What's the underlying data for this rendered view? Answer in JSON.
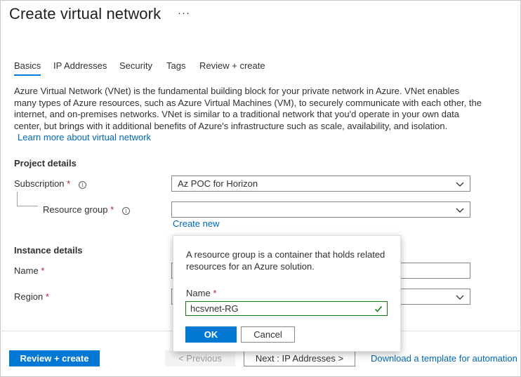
{
  "header": {
    "title": "Create virtual network",
    "more": "···"
  },
  "tabs": [
    {
      "label": "Basics"
    },
    {
      "label": "IP Addresses"
    },
    {
      "label": "Security"
    },
    {
      "label": "Tags"
    },
    {
      "label": "Review + create"
    }
  ],
  "description": {
    "line1": "Azure Virtual Network (VNet) is the fundamental building block for your private network in Azure. VNet enables",
    "line2": "many types of Azure resources, such as Azure Virtual Machines (VM), to securely communicate with each other, the",
    "line3": "internet, and on-premises networks. VNet is similar to a traditional network that you'd operate in your own data",
    "line4": "center, but brings with it additional benefits of Azure's infrastructure such as scale, availability, and isolation.",
    "learn_more": "Learn more about virtual network"
  },
  "project": {
    "heading": "Project details",
    "subscription_label": "Subscription",
    "subscription_value": "Az POC for Horizon",
    "resource_group_label": "Resource group",
    "resource_group_value": "",
    "create_new": "Create new",
    "required_mark": "*",
    "info_glyph": "i"
  },
  "instance": {
    "heading": "Instance details",
    "name_label": "Name",
    "region_label": "Region"
  },
  "popup": {
    "text_line1": "A resource group is a container that holds related",
    "text_line2": "resources for an Azure solution.",
    "name_label": "Name",
    "name_value": "hcsvnet-RG",
    "ok": "OK",
    "cancel": "Cancel"
  },
  "footer": {
    "review_create": "Review + create",
    "previous": "< Previous",
    "next": "Next : IP Addresses >",
    "download": "Download a template for automation"
  },
  "colors": {
    "accent": "#0078d4",
    "link": "#0067b8",
    "required": "#a4262c",
    "valid": "#107c10"
  }
}
